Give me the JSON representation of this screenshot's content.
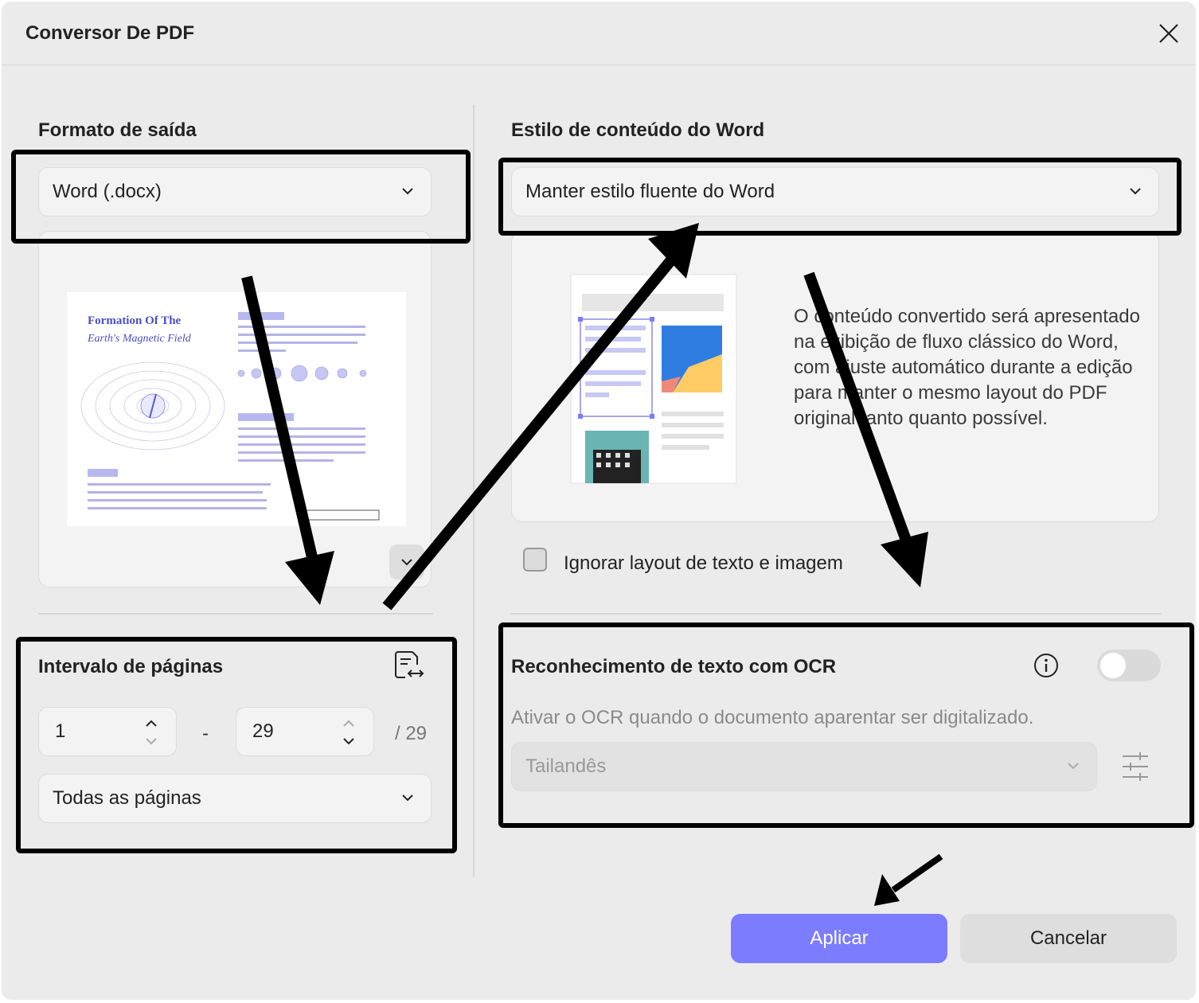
{
  "window": {
    "title": "Conversor De PDF"
  },
  "left": {
    "output_format_title": "Formato de saída",
    "output_format_value": "Word (.docx)",
    "preview": {
      "doc_title_line1": "Formation Of The",
      "doc_title_line2": "Earth's Magnetic Field"
    },
    "page_range": {
      "title": "Intervalo de páginas",
      "from": "1",
      "separator": "-",
      "to": "29",
      "total": "/ 29",
      "pages_select": "Todas as páginas"
    }
  },
  "right": {
    "word_style_title": "Estilo de conteúdo do Word",
    "word_style_value": "Manter estilo fluente do Word",
    "description": "O conteúdo convertido será apresentado na exibição de fluxo clássico do Word, com ajuste automático durante a edição para manter o mesmo layout do PDF original tanto quanto possível.",
    "ignore_layout_label": "Ignorar layout de texto e imagem",
    "ignore_layout_checked": false,
    "ocr": {
      "title": "Reconhecimento de texto com OCR",
      "enabled": false,
      "hint": "Ativar o OCR quando o documento aparentar ser digitalizado.",
      "language": "Tailandês"
    }
  },
  "footer": {
    "apply_label": "Aplicar",
    "cancel_label": "Cancelar"
  },
  "colors": {
    "accent": "#7b7cff",
    "annotation": "#000000"
  }
}
